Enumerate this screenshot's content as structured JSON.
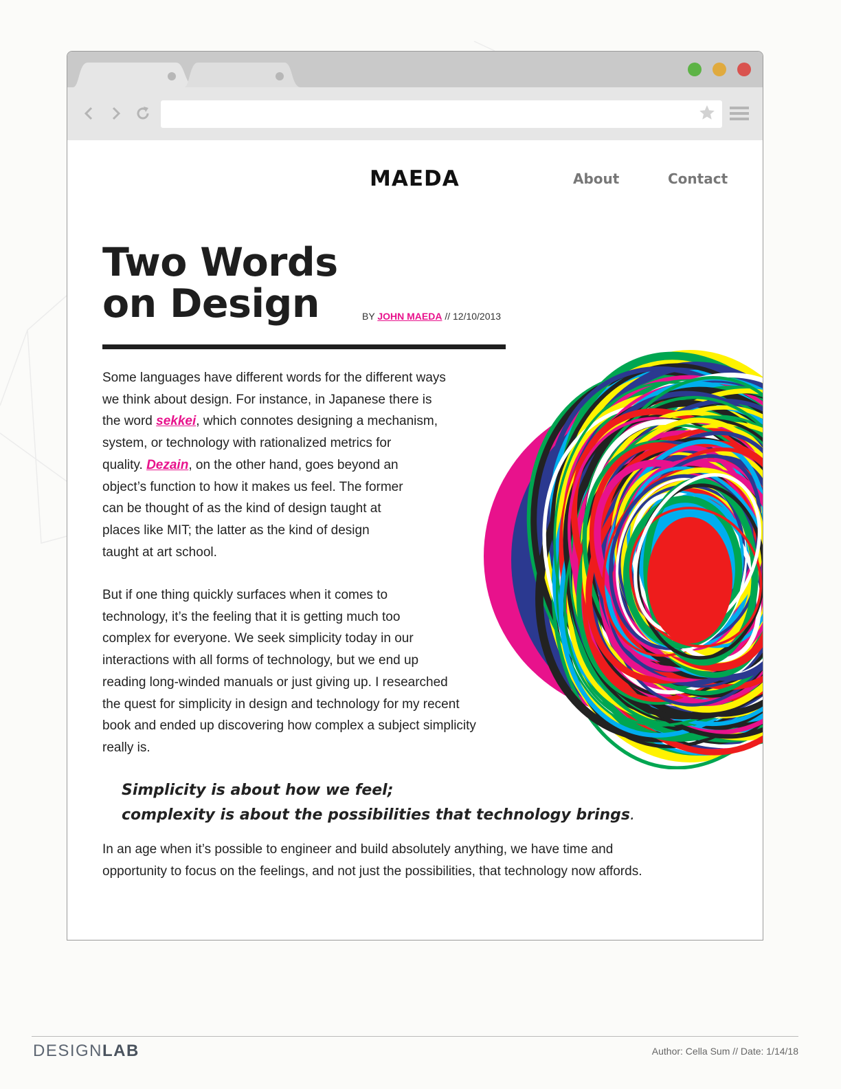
{
  "browser": {
    "url": "",
    "icons": [
      "back-icon",
      "forward-icon",
      "reload-icon",
      "star-icon",
      "menu-icon"
    ],
    "window_colors": {
      "green": "#5db346",
      "yellow": "#e0aa3e",
      "red": "#d9534f"
    }
  },
  "site": {
    "logo": "MAEDA",
    "nav": [
      "About",
      "Contact"
    ],
    "accent_color": "#e8128c"
  },
  "article": {
    "title_line1": "Two Words",
    "title_line2": "on Design",
    "byline_prefix": "BY ",
    "author": "JOHN MAEDA",
    "byline_separator": " // ",
    "date": "12/10/2013",
    "p1": {
      "l1": "Some languages have different words for the different ways",
      "l2": "we think about design. For instance, in Japanese there is",
      "l3_pre": "the word ",
      "l3_link": "sekkei",
      "l3_post": ", which connotes designing a mechanism,",
      "l4": "system, or technology with rationalized metrics for",
      "l5_pre": "quality. ",
      "l5_link": "Dezain",
      "l5_post": ", on the other hand, goes beyond an",
      "l6": "object’s function to how it makes us feel. The former",
      "l7": "can be thought of as the kind of design taught at",
      "l8": "places like MIT; the latter as the kind of design",
      "l9": "taught at art school."
    },
    "p2": [
      "But if one thing quickly surfaces when it comes to",
      "technology, it’s the feeling that it is getting much too",
      "complex for everyone. We seek simplicity today in our",
      "interactions with all forms of technology, but we end up",
      "reading long-winded manuals or just giving up. I researched",
      "the quest for simplicity in design and technology for my recent",
      "book and ended up discovering how complex a subject simplicity",
      "really is."
    ],
    "quote_line1": "Simplicity is about how we feel;",
    "quote_line2": "complexity is about the possibilities that technology brings",
    "quote_end": ".",
    "p3": [
      "In an age when it’s possible to engineer and build absolutely anything, we have time and",
      "opportunity to focus on the feelings, and not just the possibilities, that technology now affords."
    ]
  },
  "footer": {
    "brand_light": "DESIGN",
    "brand_bold": "LAB",
    "credit": "Author: Cella Sum  //  Date: 1/14/18"
  }
}
